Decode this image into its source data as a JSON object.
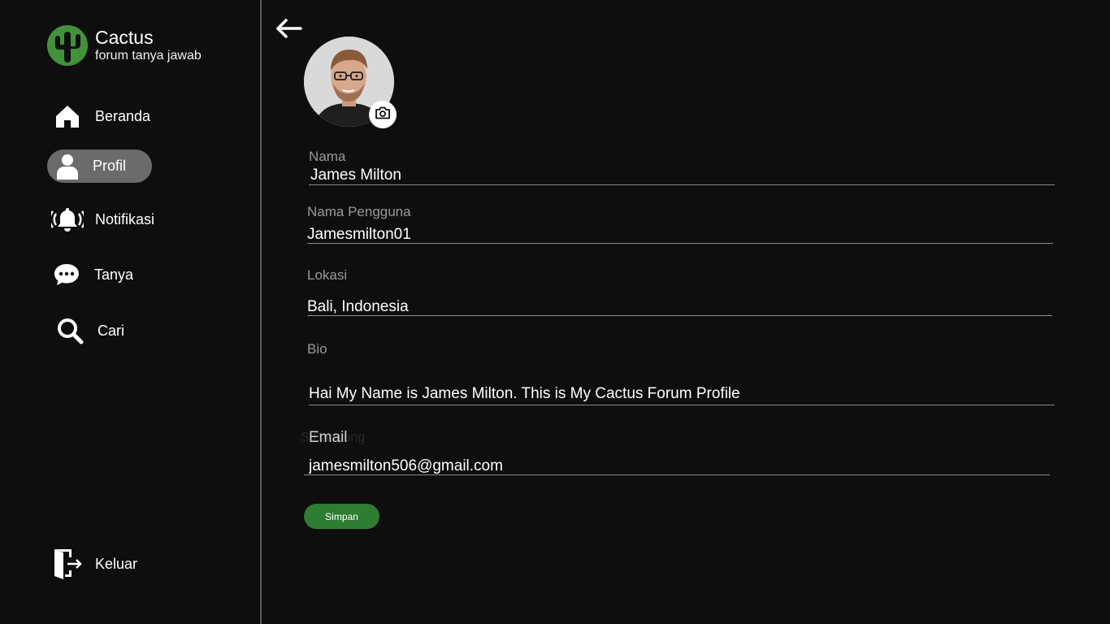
{
  "brand": {
    "title": "Cactus",
    "subtitle": "forum tanya jawab",
    "logo_icon": "cactus-icon",
    "logo_color": "#43913a"
  },
  "sidebar": {
    "items": [
      {
        "label": "Beranda",
        "icon": "home-icon"
      },
      {
        "label": "Profil",
        "icon": "user-icon",
        "active": true
      },
      {
        "label": "Notifikasi",
        "icon": "bell-ringing-icon"
      },
      {
        "label": "Tanya",
        "icon": "chat-bubble-icon"
      },
      {
        "label": "Cari",
        "icon": "search-icon"
      }
    ],
    "logout": {
      "label": "Keluar",
      "icon": "logout-door-icon"
    }
  },
  "form": {
    "nama": {
      "label": "Nama",
      "value": "James Milton"
    },
    "username": {
      "label": "Nama Pengguna",
      "value": "Jamesmilton01"
    },
    "lokasi": {
      "label": "Lokasi",
      "value": "Bali, Indonesia"
    },
    "bio": {
      "label": "Bio",
      "value": "Hai My Name is James Milton. This is My Cactus Forum Profile"
    },
    "email": {
      "label": "Email",
      "value": "jamesmilton506@gmail.com"
    },
    "ghost_text": "S        Bandung",
    "save_label": "Simpan"
  },
  "colors": {
    "background": "#0e0e0e",
    "accent_green": "#2e7d32",
    "active_pill": "#6b6b6b"
  }
}
